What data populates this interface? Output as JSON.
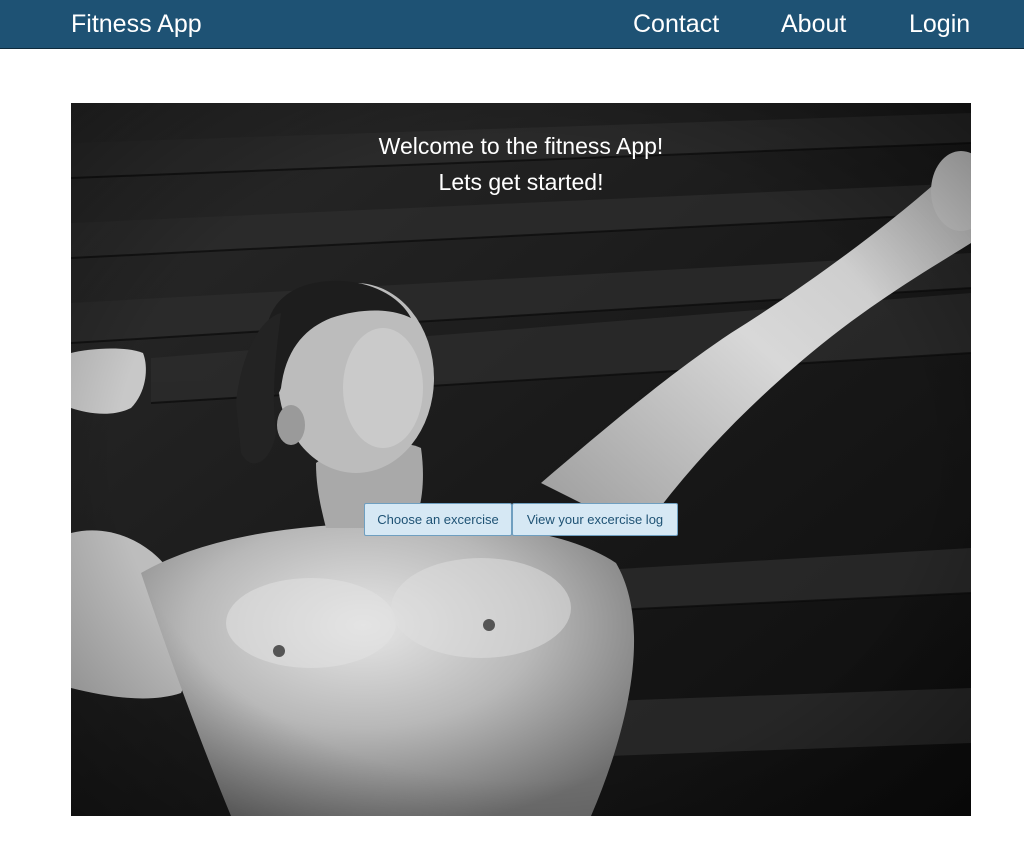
{
  "navbar": {
    "brand": "Fitness App",
    "links": [
      "Contact",
      "About",
      "Login"
    ],
    "background": "#1e5274"
  },
  "hero": {
    "image": "black-and-white-bodybuilder-photo",
    "welcome": "Welcome to the fitness App!",
    "tagline": "Lets get started!",
    "buttons": {
      "choose": "Choose an excercise",
      "log": "View your excercise log"
    }
  }
}
